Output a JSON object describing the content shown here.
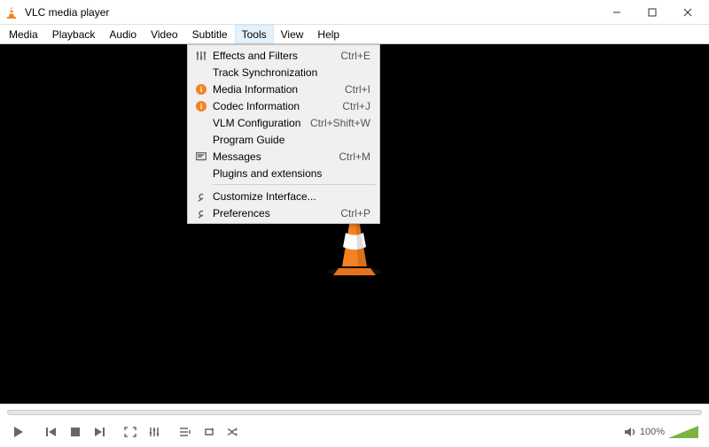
{
  "titlebar": {
    "title": "VLC media player"
  },
  "menubar": {
    "items": [
      "Media",
      "Playback",
      "Audio",
      "Video",
      "Subtitle",
      "Tools",
      "View",
      "Help"
    ],
    "open_index": 5
  },
  "tools_menu": {
    "items": [
      {
        "icon": "sliders",
        "label": "Effects and Filters",
        "shortcut": "Ctrl+E"
      },
      {
        "icon": "",
        "label": "Track Synchronization",
        "shortcut": ""
      },
      {
        "icon": "info",
        "label": "Media Information",
        "shortcut": "Ctrl+I"
      },
      {
        "icon": "info",
        "label": "Codec Information",
        "shortcut": "Ctrl+J"
      },
      {
        "icon": "",
        "label": "VLM Configuration",
        "shortcut": "Ctrl+Shift+W"
      },
      {
        "icon": "",
        "label": "Program Guide",
        "shortcut": ""
      },
      {
        "icon": "messages",
        "label": "Messages",
        "shortcut": "Ctrl+M"
      },
      {
        "icon": "",
        "label": "Plugins and extensions",
        "shortcut": ""
      },
      {
        "sep": true
      },
      {
        "icon": "wrench",
        "label": "Customize Interface...",
        "shortcut": ""
      },
      {
        "icon": "wrench",
        "label": "Preferences",
        "shortcut": "Ctrl+P"
      }
    ]
  },
  "controls": {
    "volume_label": "100%"
  }
}
